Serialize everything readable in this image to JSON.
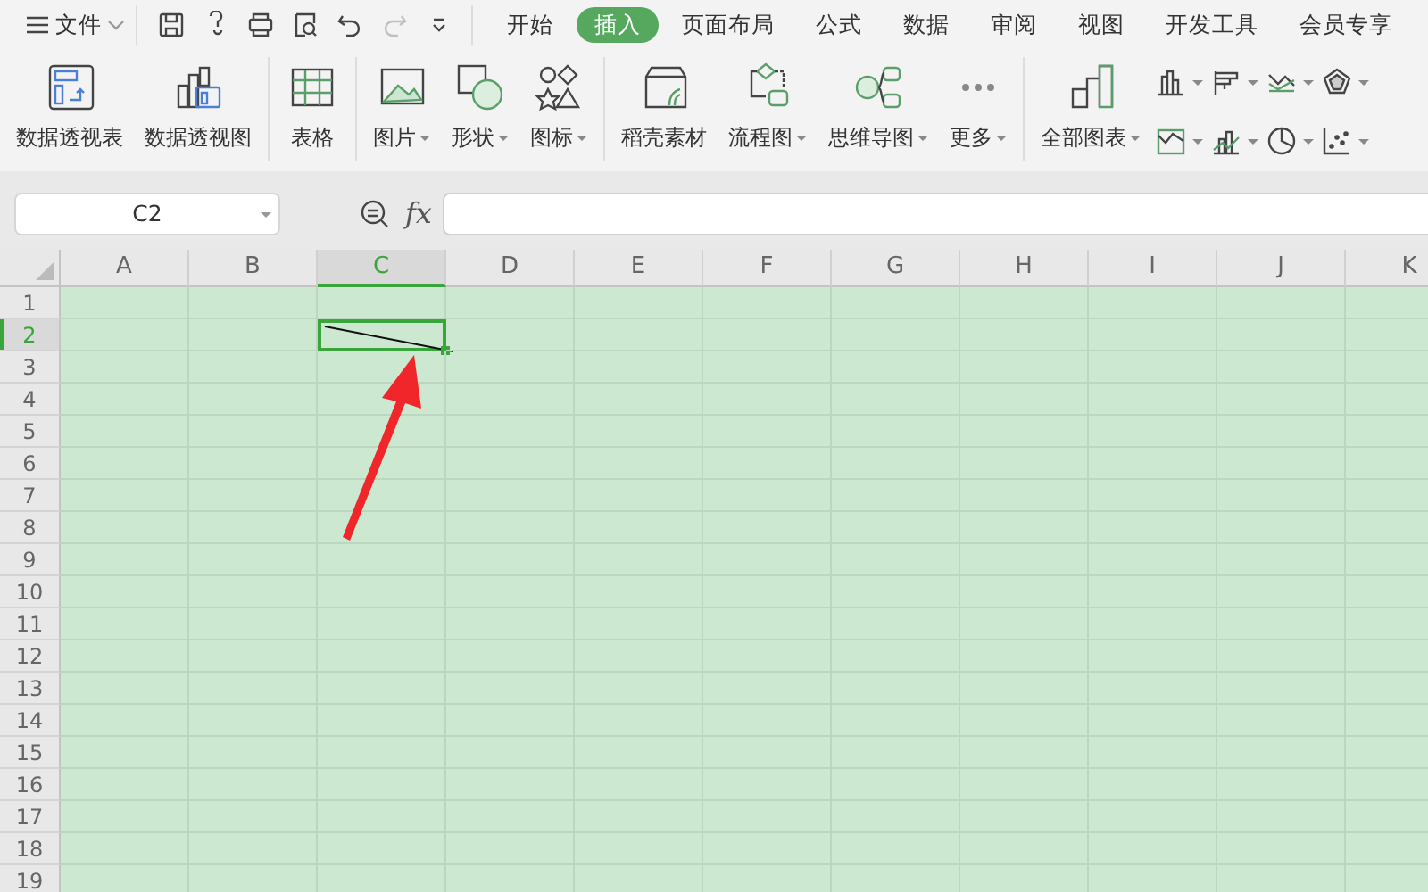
{
  "menu_bar": {
    "file_menu": "文件",
    "tabs": [
      {
        "label": "开始",
        "selected": false
      },
      {
        "label": "插入",
        "selected": true
      },
      {
        "label": "页面布局",
        "selected": false
      },
      {
        "label": "公式",
        "selected": false
      },
      {
        "label": "数据",
        "selected": false
      },
      {
        "label": "审阅",
        "selected": false
      },
      {
        "label": "视图",
        "selected": false
      },
      {
        "label": "开发工具",
        "selected": false
      },
      {
        "label": "会员专享",
        "selected": false
      }
    ],
    "redo_disabled": true
  },
  "ribbon": {
    "groups": [
      [
        {
          "label": "数据透视表",
          "dropdown": false
        },
        {
          "label": "数据透视图",
          "dropdown": false
        }
      ],
      [
        {
          "label": "表格",
          "dropdown": false
        }
      ],
      [
        {
          "label": "图片",
          "dropdown": true
        },
        {
          "label": "形状",
          "dropdown": true
        },
        {
          "label": "图标",
          "dropdown": true
        }
      ],
      [
        {
          "label": "稻壳素材",
          "dropdown": false
        },
        {
          "label": "流程图",
          "dropdown": true
        },
        {
          "label": "思维导图",
          "dropdown": true
        },
        {
          "label": "更多",
          "dropdown": true
        }
      ],
      [
        {
          "label": "全部图表",
          "dropdown": true
        }
      ]
    ]
  },
  "formula_bar": {
    "name_box": "C2",
    "fx": "fx"
  },
  "sheet": {
    "columns": [
      {
        "label": "A",
        "selected": false
      },
      {
        "label": "B",
        "selected": false
      },
      {
        "label": "C",
        "selected": true
      },
      {
        "label": "D",
        "selected": false
      },
      {
        "label": "E",
        "selected": false
      },
      {
        "label": "F",
        "selected": false
      },
      {
        "label": "G",
        "selected": false
      },
      {
        "label": "H",
        "selected": false
      },
      {
        "label": "I",
        "selected": false
      },
      {
        "label": "J",
        "selected": false
      },
      {
        "label": "K",
        "selected": false
      }
    ],
    "rows": [
      {
        "label": "1",
        "selected": false
      },
      {
        "label": "2",
        "selected": true
      },
      {
        "label": "3",
        "selected": false
      },
      {
        "label": "4",
        "selected": false
      },
      {
        "label": "5",
        "selected": false
      },
      {
        "label": "6",
        "selected": false
      },
      {
        "label": "7",
        "selected": false
      },
      {
        "label": "8",
        "selected": false
      },
      {
        "label": "9",
        "selected": false
      },
      {
        "label": "10",
        "selected": false
      },
      {
        "label": "11",
        "selected": false
      },
      {
        "label": "12",
        "selected": false
      },
      {
        "label": "13",
        "selected": false
      },
      {
        "label": "14",
        "selected": false
      },
      {
        "label": "15",
        "selected": false
      },
      {
        "label": "16",
        "selected": false
      },
      {
        "label": "17",
        "selected": false
      },
      {
        "label": "18",
        "selected": false
      },
      {
        "label": "19",
        "selected": false
      }
    ],
    "selection_diagonal_line": true
  }
}
